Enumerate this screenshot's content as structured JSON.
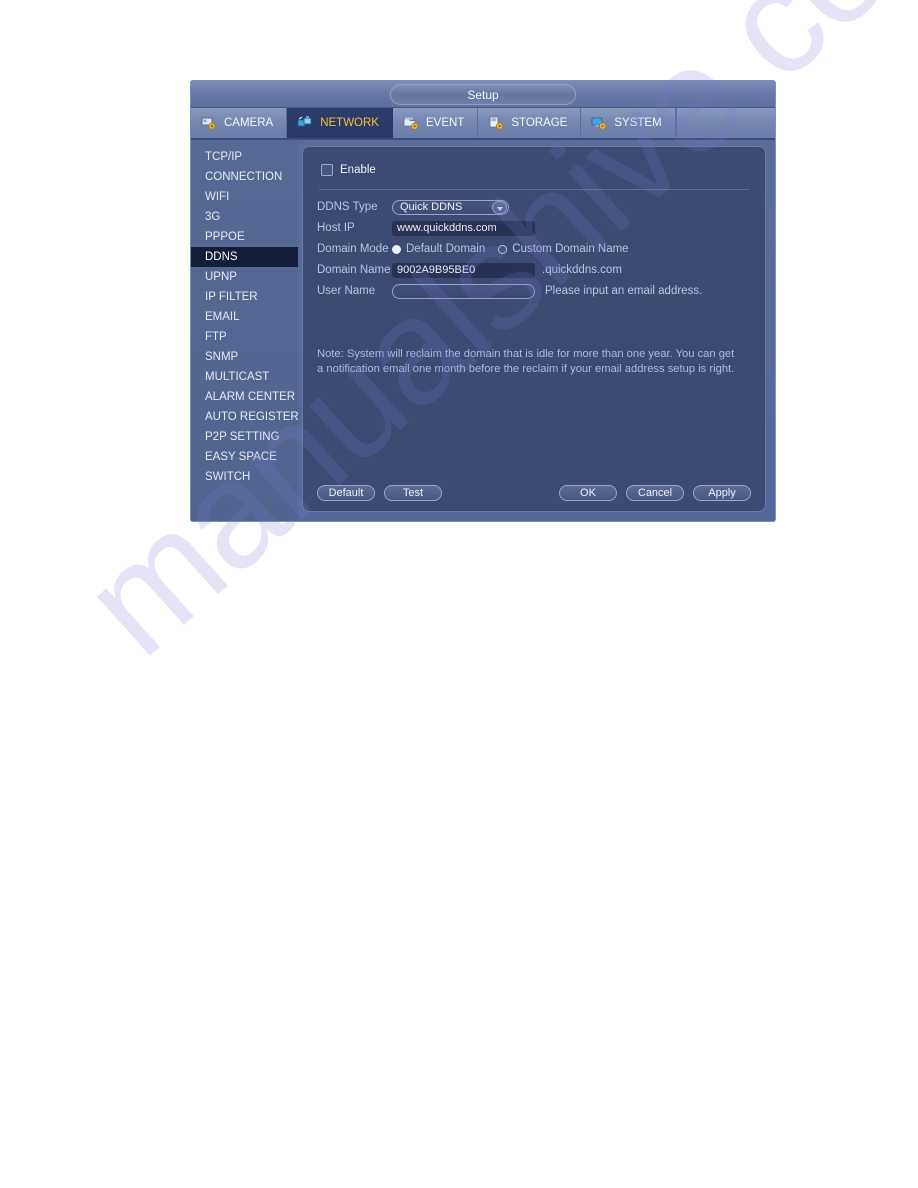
{
  "window": {
    "title": "Setup"
  },
  "tabs": [
    {
      "label": "CAMERA",
      "icon": "camera-icon",
      "active": false
    },
    {
      "label": "NETWORK",
      "icon": "network-icon",
      "active": true
    },
    {
      "label": "EVENT",
      "icon": "event-icon",
      "active": false
    },
    {
      "label": "STORAGE",
      "icon": "storage-icon",
      "active": false
    },
    {
      "label": "SYSTEM",
      "icon": "system-icon",
      "active": false
    }
  ],
  "sidebar": {
    "items": [
      {
        "label": "TCP/IP",
        "active": false
      },
      {
        "label": "CONNECTION",
        "active": false
      },
      {
        "label": "WIFI",
        "active": false
      },
      {
        "label": "3G",
        "active": false
      },
      {
        "label": "PPPOE",
        "active": false
      },
      {
        "label": "DDNS",
        "active": true
      },
      {
        "label": "UPNP",
        "active": false
      },
      {
        "label": "IP FILTER",
        "active": false
      },
      {
        "label": "EMAIL",
        "active": false
      },
      {
        "label": "FTP",
        "active": false
      },
      {
        "label": "SNMP",
        "active": false
      },
      {
        "label": "MULTICAST",
        "active": false
      },
      {
        "label": "ALARM CENTER",
        "active": false
      },
      {
        "label": "AUTO REGISTER",
        "active": false
      },
      {
        "label": "P2P SETTING",
        "active": false
      },
      {
        "label": "EASY SPACE",
        "active": false
      },
      {
        "label": "SWITCH",
        "active": false
      }
    ]
  },
  "form": {
    "enable": {
      "label": "Enable",
      "checked": false
    },
    "ddns_type": {
      "label": "DDNS Type",
      "value": "Quick DDNS"
    },
    "host_ip": {
      "label": "Host IP",
      "value": "www.quickddns.com"
    },
    "domain_mode": {
      "label": "Domain Mode",
      "option_default": "Default Domain",
      "option_custom": "Custom Domain Name",
      "selected": "Default Domain"
    },
    "domain_name": {
      "label": "Domain Name",
      "value": "9002A9B95BE0",
      "suffix": ".quickddns.com"
    },
    "user_name": {
      "label": "User Name",
      "value": "",
      "hint": "Please input an email address."
    },
    "note": "Note: System will reclaim the domain that is idle for more than one year. You can get a notification email one month before the reclaim if your email address setup is right."
  },
  "footer": {
    "default_label": "Default",
    "test_label": "Test",
    "ok_label": "OK",
    "cancel_label": "Cancel",
    "apply_label": "Apply"
  },
  "watermark": {
    "text": "manualshive.com"
  },
  "colors": {
    "accent_active_tab_text": "#f2c03c",
    "panel_bg": "#3d4a73",
    "sidebar_active_bg": "#151d38",
    "label_text": "#b9c4e4"
  }
}
